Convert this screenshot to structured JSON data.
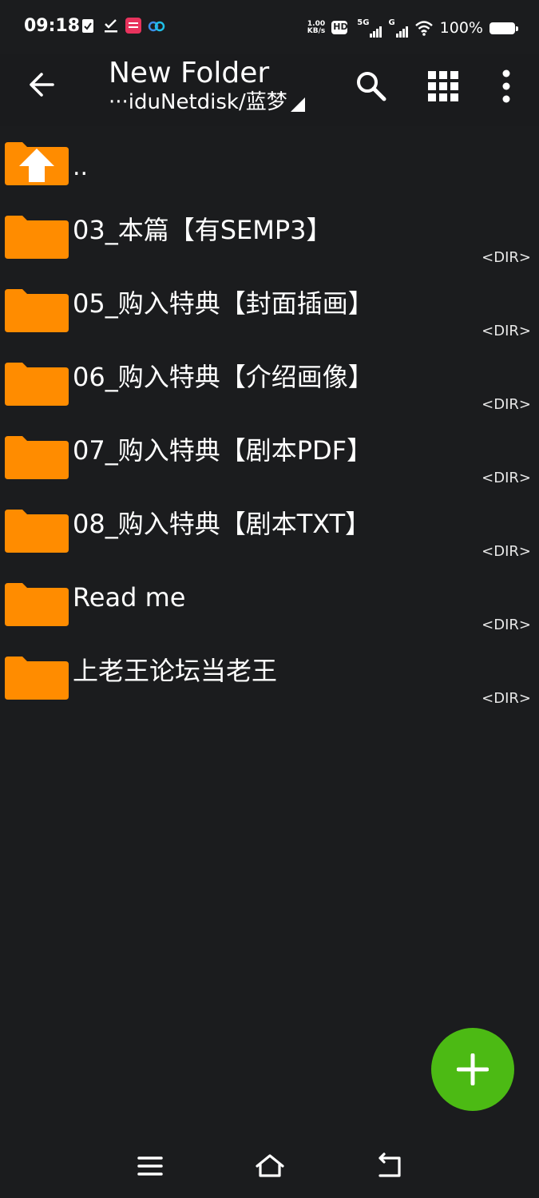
{
  "status_bar": {
    "time": "09:18",
    "net_speed_value": "1.00",
    "net_speed_unit": "KB/s",
    "hd_label": "HD",
    "sim1_label": "5G",
    "sim2_label": "G",
    "battery_percent": "100%"
  },
  "header": {
    "title": "New Folder",
    "path": "···iduNetdisk/蓝梦"
  },
  "files": {
    "parent": {
      "name": ".."
    },
    "items": [
      {
        "name": "03_本篇【有SEMP3】",
        "type": "<DIR>"
      },
      {
        "name": "05_购入特典【封面插画】",
        "type": "<DIR>"
      },
      {
        "name": "06_购入特典【介绍画像】",
        "type": "<DIR>"
      },
      {
        "name": "07_购入特典【剧本PDF】",
        "type": "<DIR>"
      },
      {
        "name": "08_购入特典【剧本TXT】",
        "type": "<DIR>"
      },
      {
        "name": "Read me",
        "type": "<DIR>"
      },
      {
        "name": "上老王论坛当老王",
        "type": "<DIR>"
      }
    ]
  },
  "colors": {
    "background": "#1b1c1e",
    "folder": "#ff8c00",
    "fab": "#4cba14"
  },
  "icons": {
    "back": "arrow-left-icon",
    "search": "search-icon",
    "view": "grid-view-icon",
    "more": "more-vertical-icon",
    "folder": "folder-icon",
    "parent": "folder-up-icon",
    "fab": "plus-icon",
    "nav_menu": "menu-icon",
    "nav_home": "home-icon",
    "nav_back": "back-icon"
  }
}
